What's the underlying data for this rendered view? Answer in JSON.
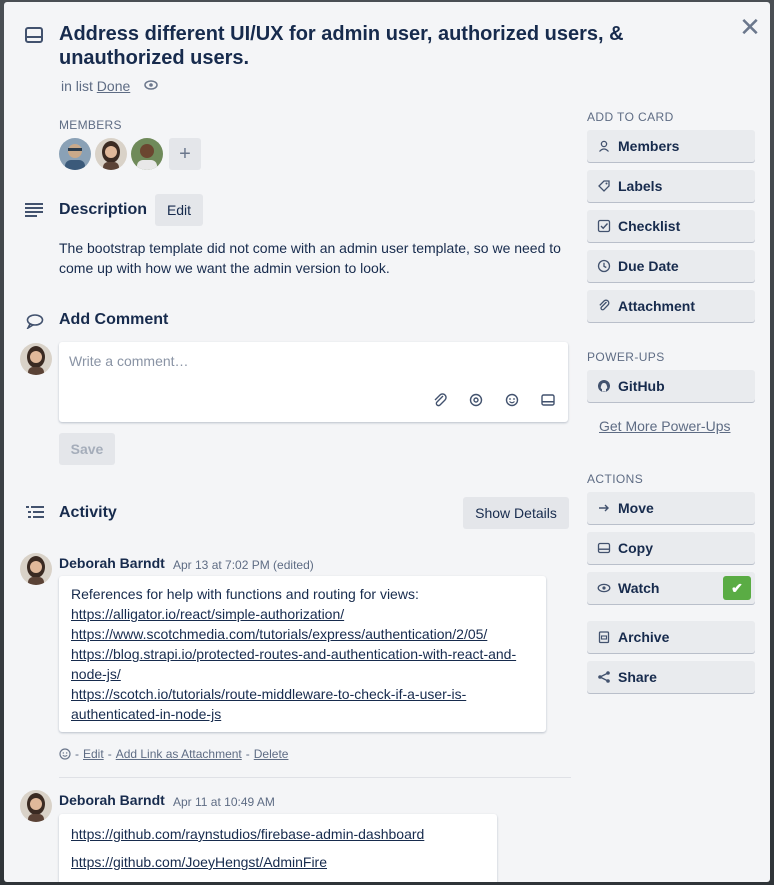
{
  "card": {
    "title": "Address different UI/UX for admin user, authorized users, & unauthorized users.",
    "in_list_prefix": "in list",
    "list_name": "Done"
  },
  "members": {
    "label": "MEMBERS",
    "add_label": "+"
  },
  "description": {
    "title": "Description",
    "edit_label": "Edit",
    "text": "The bootstrap template did not come with an admin user template, so we need to come up with how we want the admin version to look."
  },
  "comment": {
    "title": "Add Comment",
    "placeholder": "Write a comment…",
    "save_label": "Save"
  },
  "activity": {
    "title": "Activity",
    "show_details_label": "Show Details",
    "entries": [
      {
        "author": "Deborah Barndt",
        "time": "Apr 13 at 7:02 PM (edited)",
        "intro": "References for help with functions and routing for views:",
        "links": [
          "https://alligator.io/react/simple-authorization/",
          "https://www.scotchmedia.com/tutorials/express/authentication/2/05/",
          "https://blog.strapi.io/protected-routes-and-authentication-with-react-and-node-js/",
          "https://scotch.io/tutorials/route-middleware-to-check-if-a-user-is-authenticated-in-node-js"
        ],
        "actions": {
          "sep": "-",
          "edit": "Edit",
          "add_link": "Add Link as Attachment",
          "delete": "Delete"
        }
      },
      {
        "author": "Deborah Barndt",
        "time": "Apr 11 at 10:49 AM",
        "links": [
          "https://github.com/raynstudios/firebase-admin-dashboard",
          "https://github.com/JoeyHengst/AdminFire"
        ]
      }
    ]
  },
  "sidebar": {
    "add_to_card_label": "ADD TO CARD",
    "add_items": [
      "Members",
      "Labels",
      "Checklist",
      "Due Date",
      "Attachment"
    ],
    "power_ups_label": "POWER-UPS",
    "power_ups": [
      "GitHub"
    ],
    "get_more_label": "Get More Power-Ups",
    "actions_label": "ACTIONS",
    "actions": [
      "Move",
      "Copy",
      "Watch",
      "Archive",
      "Share"
    ]
  },
  "colors": {
    "watch_check": "#5aac44",
    "panel_bg": "#f4f5f7",
    "button_bg": "#e9ebee"
  }
}
